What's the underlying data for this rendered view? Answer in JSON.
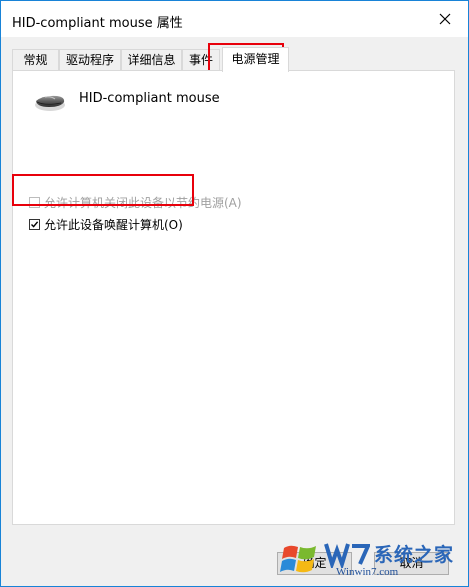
{
  "window": {
    "title": "HID-compliant mouse 属性"
  },
  "tabs": [
    {
      "label": "常规"
    },
    {
      "label": "驱动程序"
    },
    {
      "label": "详细信息"
    },
    {
      "label": "事件"
    },
    {
      "label": "电源管理"
    }
  ],
  "active_tab": "电源管理",
  "device": {
    "name": "HID-compliant mouse",
    "icon": "mouse-icon"
  },
  "options": [
    {
      "label": "允许计算机关闭此设备以节约电源(A)",
      "checked": false,
      "enabled": false
    },
    {
      "label": "允许此设备唤醒计算机(O)",
      "checked": true,
      "enabled": true
    }
  ],
  "buttons": {
    "ok": "确定",
    "cancel": "取消"
  },
  "watermark": {
    "line1": "系统之家",
    "line2": "Winwin7.com"
  },
  "colors": {
    "highlight": "#e8000b",
    "window_border": "#1883d7"
  }
}
